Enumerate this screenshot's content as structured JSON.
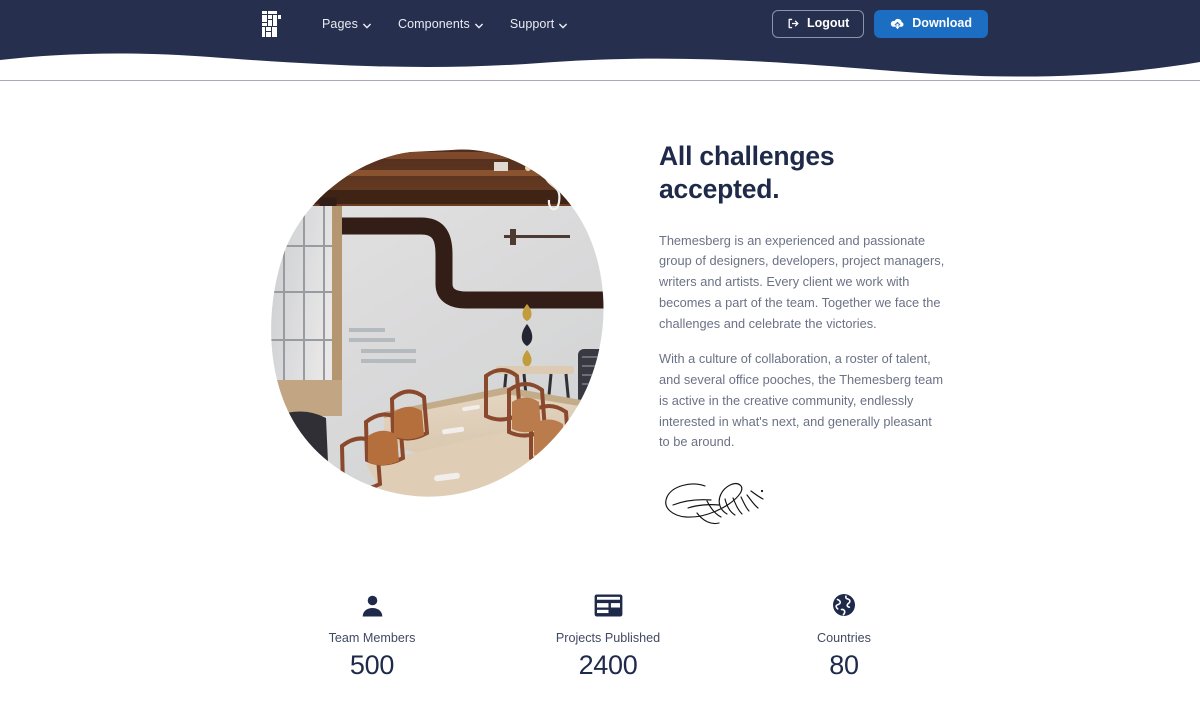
{
  "navbar": {
    "logo_name": "themesberg-pixel-logo",
    "links": [
      {
        "label": "Pages",
        "icon": "chevron-down-icon"
      },
      {
        "label": "Components",
        "icon": "chevron-down-icon"
      },
      {
        "label": "Support",
        "icon": "chevron-down-icon"
      }
    ],
    "logout_label": "Logout",
    "logout_icon": "sign-out-icon",
    "download_label": "Download",
    "download_icon": "cloud-download-icon",
    "background_color": "#262f4e",
    "accent_color": "#1b6ec2"
  },
  "about": {
    "image_alt": "office-meeting-room-photo",
    "title": "All challenges accepted.",
    "paragraphs": [
      "Themesberg is an experienced and passionate group of designers, developers, project managers, writers and artists. Every client we work with becomes a part of the team. Together we face the challenges and celebrate the victories.",
      "With a culture of collaboration, a roster of talent, and several office pooches, the Themesberg team is active in the creative community, endlessly interested in what's next, and generally pleasant to be around."
    ],
    "signature_alt": "handwritten-signature",
    "heading_color": "#1f2a4a",
    "body_color": "#6b7286"
  },
  "stats": [
    {
      "icon": "user-icon",
      "label": "Team Members",
      "value": "500"
    },
    {
      "icon": "id-card-icon",
      "label": "Projects Published",
      "value": "2400"
    },
    {
      "icon": "globe-icon",
      "label": "Countries",
      "value": "80"
    }
  ]
}
